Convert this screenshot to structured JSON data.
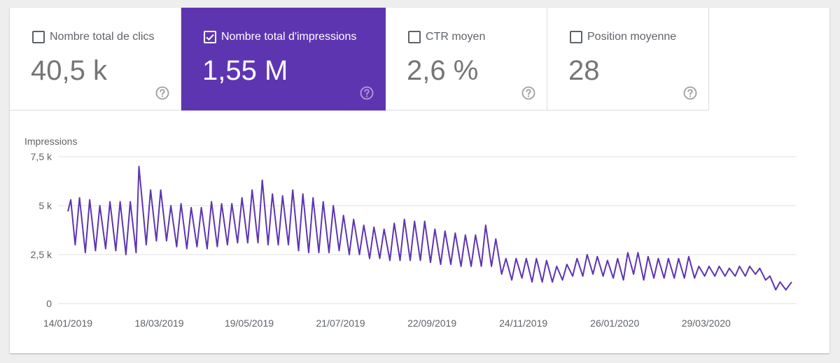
{
  "metrics": [
    {
      "label": "Nombre total de clics",
      "value": "40,5 k",
      "checked": false
    },
    {
      "label": "Nombre total d'impressions",
      "value": "1,55 M",
      "checked": true
    },
    {
      "label": "CTR moyen",
      "value": "2,6 %",
      "checked": false
    },
    {
      "label": "Position moyenne",
      "value": "28",
      "checked": false
    }
  ],
  "colors": {
    "accent": "#5e35b1",
    "line": "#5e35b1",
    "grid": "#e0e0e0"
  },
  "icons": {
    "help": "help-circle-icon",
    "checkbox": "checkbox-icon"
  },
  "chart_data": {
    "type": "line",
    "ylabel": "Impressions",
    "ylim": [
      0,
      7500
    ],
    "yticks": [
      0,
      2500,
      5000,
      7500
    ],
    "ytick_labels": [
      "0",
      "2,5 k",
      "5 k",
      "7,5 k"
    ],
    "xlim": [
      "2019-01-14",
      "2020-05-27"
    ],
    "xtick_labels": [
      "14/01/2019",
      "18/03/2019",
      "19/05/2019",
      "21/07/2019",
      "22/09/2019",
      "24/11/2019",
      "26/01/2020",
      "29/03/2020"
    ],
    "series": [
      {
        "points": [
          [
            "2019-01-14",
            4700
          ],
          [
            "2019-01-16",
            5300
          ],
          [
            "2019-01-19",
            3000
          ],
          [
            "2019-01-22",
            5400
          ],
          [
            "2019-01-26",
            2600
          ],
          [
            "2019-01-29",
            5300
          ],
          [
            "2019-02-02",
            2700
          ],
          [
            "2019-02-05",
            5000
          ],
          [
            "2019-02-09",
            2800
          ],
          [
            "2019-02-12",
            5200
          ],
          [
            "2019-02-16",
            2700
          ],
          [
            "2019-02-19",
            5200
          ],
          [
            "2019-02-23",
            2500
          ],
          [
            "2019-02-26",
            5200
          ],
          [
            "2019-03-02",
            2600
          ],
          [
            "2019-03-04",
            7000
          ],
          [
            "2019-03-09",
            3000
          ],
          [
            "2019-03-12",
            5800
          ],
          [
            "2019-03-16",
            3200
          ],
          [
            "2019-03-19",
            5800
          ],
          [
            "2019-03-23",
            3200
          ],
          [
            "2019-03-26",
            5000
          ],
          [
            "2019-03-30",
            2900
          ],
          [
            "2019-04-02",
            5100
          ],
          [
            "2019-04-06",
            2800
          ],
          [
            "2019-04-09",
            4900
          ],
          [
            "2019-04-13",
            2900
          ],
          [
            "2019-04-16",
            4900
          ],
          [
            "2019-04-20",
            2800
          ],
          [
            "2019-04-23",
            5200
          ],
          [
            "2019-04-27",
            2900
          ],
          [
            "2019-04-30",
            5100
          ],
          [
            "2019-05-04",
            3000
          ],
          [
            "2019-05-07",
            5100
          ],
          [
            "2019-05-11",
            3100
          ],
          [
            "2019-05-14",
            5400
          ],
          [
            "2019-05-18",
            3100
          ],
          [
            "2019-05-21",
            5800
          ],
          [
            "2019-05-25",
            3100
          ],
          [
            "2019-05-28",
            6300
          ],
          [
            "2019-06-01",
            3000
          ],
          [
            "2019-06-04",
            5600
          ],
          [
            "2019-06-08",
            3000
          ],
          [
            "2019-06-11",
            5500
          ],
          [
            "2019-06-15",
            3000
          ],
          [
            "2019-06-18",
            5800
          ],
          [
            "2019-06-22",
            2700
          ],
          [
            "2019-06-25",
            5600
          ],
          [
            "2019-06-29",
            2600
          ],
          [
            "2019-07-02",
            5400
          ],
          [
            "2019-07-06",
            2600
          ],
          [
            "2019-07-09",
            5200
          ],
          [
            "2019-07-13",
            2600
          ],
          [
            "2019-07-16",
            5000
          ],
          [
            "2019-07-20",
            2700
          ],
          [
            "2019-07-23",
            4500
          ],
          [
            "2019-07-27",
            2500
          ],
          [
            "2019-07-30",
            4300
          ],
          [
            "2019-08-03",
            2500
          ],
          [
            "2019-08-06",
            4000
          ],
          [
            "2019-08-10",
            2300
          ],
          [
            "2019-08-13",
            3900
          ],
          [
            "2019-08-17",
            2300
          ],
          [
            "2019-08-20",
            3800
          ],
          [
            "2019-08-24",
            2200
          ],
          [
            "2019-08-27",
            4100
          ],
          [
            "2019-08-31",
            2200
          ],
          [
            "2019-09-03",
            4300
          ],
          [
            "2019-09-07",
            2200
          ],
          [
            "2019-09-10",
            4200
          ],
          [
            "2019-09-14",
            2200
          ],
          [
            "2019-09-17",
            4200
          ],
          [
            "2019-09-21",
            2100
          ],
          [
            "2019-09-24",
            3800
          ],
          [
            "2019-09-28",
            2000
          ],
          [
            "2019-10-01",
            3700
          ],
          [
            "2019-10-05",
            2000
          ],
          [
            "2019-10-08",
            3600
          ],
          [
            "2019-10-12",
            1900
          ],
          [
            "2019-10-15",
            3500
          ],
          [
            "2019-10-19",
            1900
          ],
          [
            "2019-10-22",
            3500
          ],
          [
            "2019-10-26",
            1900
          ],
          [
            "2019-10-29",
            4000
          ],
          [
            "2019-11-02",
            1900
          ],
          [
            "2019-11-05",
            3300
          ],
          [
            "2019-11-09",
            1500
          ],
          [
            "2019-11-12",
            2300
          ],
          [
            "2019-11-16",
            1200
          ],
          [
            "2019-11-19",
            2300
          ],
          [
            "2019-11-23",
            1300
          ],
          [
            "2019-11-26",
            2300
          ],
          [
            "2019-11-30",
            1100
          ],
          [
            "2019-12-03",
            2300
          ],
          [
            "2019-12-07",
            1100
          ],
          [
            "2019-12-10",
            2200
          ],
          [
            "2019-12-14",
            1100
          ],
          [
            "2019-12-17",
            1900
          ],
          [
            "2019-12-21",
            1200
          ],
          [
            "2019-12-24",
            2000
          ],
          [
            "2019-12-28",
            1400
          ],
          [
            "2019-12-31",
            2300
          ],
          [
            "2020-01-04",
            1400
          ],
          [
            "2020-01-07",
            2500
          ],
          [
            "2020-01-11",
            1500
          ],
          [
            "2020-01-14",
            2400
          ],
          [
            "2020-01-18",
            1400
          ],
          [
            "2020-01-21",
            2200
          ],
          [
            "2020-01-25",
            1300
          ],
          [
            "2020-01-28",
            2300
          ],
          [
            "2020-02-01",
            1200
          ],
          [
            "2020-02-04",
            2600
          ],
          [
            "2020-02-08",
            1500
          ],
          [
            "2020-02-11",
            2600
          ],
          [
            "2020-02-15",
            1200
          ],
          [
            "2020-02-18",
            2400
          ],
          [
            "2020-02-22",
            1300
          ],
          [
            "2020-02-25",
            2300
          ],
          [
            "2020-02-29",
            1300
          ],
          [
            "2020-03-03",
            2300
          ],
          [
            "2020-03-07",
            1300
          ],
          [
            "2020-03-10",
            2300
          ],
          [
            "2020-03-14",
            1300
          ],
          [
            "2020-03-17",
            2400
          ],
          [
            "2020-03-21",
            1300
          ],
          [
            "2020-03-24",
            1900
          ],
          [
            "2020-03-28",
            1400
          ],
          [
            "2020-03-31",
            1900
          ],
          [
            "2020-04-04",
            1400
          ],
          [
            "2020-04-07",
            1900
          ],
          [
            "2020-04-11",
            1400
          ],
          [
            "2020-04-14",
            1800
          ],
          [
            "2020-04-18",
            1400
          ],
          [
            "2020-04-21",
            1900
          ],
          [
            "2020-04-25",
            1400
          ],
          [
            "2020-04-28",
            1900
          ],
          [
            "2020-05-02",
            1500
          ],
          [
            "2020-05-05",
            1800
          ],
          [
            "2020-05-09",
            1200
          ],
          [
            "2020-05-12",
            1400
          ],
          [
            "2020-05-16",
            700
          ],
          [
            "2020-05-19",
            1100
          ],
          [
            "2020-05-23",
            700
          ],
          [
            "2020-05-27",
            1100
          ]
        ]
      }
    ]
  }
}
